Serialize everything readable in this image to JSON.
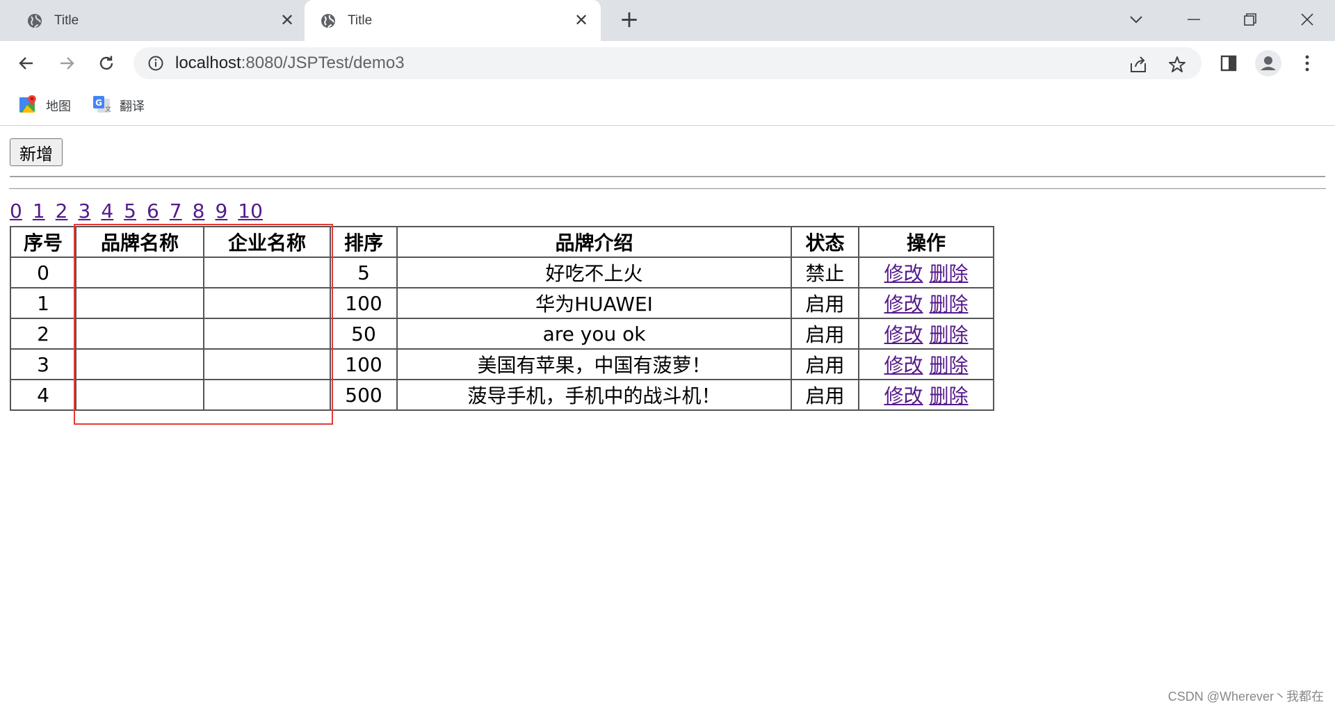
{
  "browser": {
    "tabs": [
      {
        "title": "Title",
        "active": false
      },
      {
        "title": "Title",
        "active": true
      }
    ],
    "new_tab": "+",
    "url_host": "localhost",
    "url_path": ":8080/JSPTest/demo3",
    "bookmarks": [
      {
        "label": "地图",
        "icon": "maps-icon"
      },
      {
        "label": "翻译",
        "icon": "translate-icon"
      }
    ]
  },
  "page": {
    "add_button": "新增",
    "pages": [
      "0",
      "1",
      "2",
      "3",
      "4",
      "5",
      "6",
      "7",
      "8",
      "9",
      "10"
    ],
    "table": {
      "headers": [
        "序号",
        "品牌名称",
        "企业名称",
        "排序",
        "品牌介绍",
        "状态",
        "操作"
      ],
      "rows": [
        {
          "id": "0",
          "brand": "",
          "company": "",
          "order": "5",
          "desc": "好吃不上火",
          "status": "禁止",
          "edit": "修改",
          "delete": "删除"
        },
        {
          "id": "1",
          "brand": "",
          "company": "",
          "order": "100",
          "desc": "华为HUAWEI",
          "status": "启用",
          "edit": "修改",
          "delete": "删除"
        },
        {
          "id": "2",
          "brand": "",
          "company": "",
          "order": "50",
          "desc": "are you ok",
          "status": "启用",
          "edit": "修改",
          "delete": "删除"
        },
        {
          "id": "3",
          "brand": "",
          "company": "",
          "order": "100",
          "desc": "美国有苹果，中国有菠萝！",
          "status": "启用",
          "edit": "修改",
          "delete": "删除"
        },
        {
          "id": "4",
          "brand": "",
          "company": "",
          "order": "500",
          "desc": "菠导手机，手机中的战斗机！",
          "status": "启用",
          "edit": "修改",
          "delete": "删除"
        }
      ]
    }
  },
  "watermark": "CSDN @Wherever丶我都在",
  "colors": {
    "highlight_box": "#e53935",
    "visited_link": "#551a8b",
    "tabstrip": "#dee1e6"
  }
}
